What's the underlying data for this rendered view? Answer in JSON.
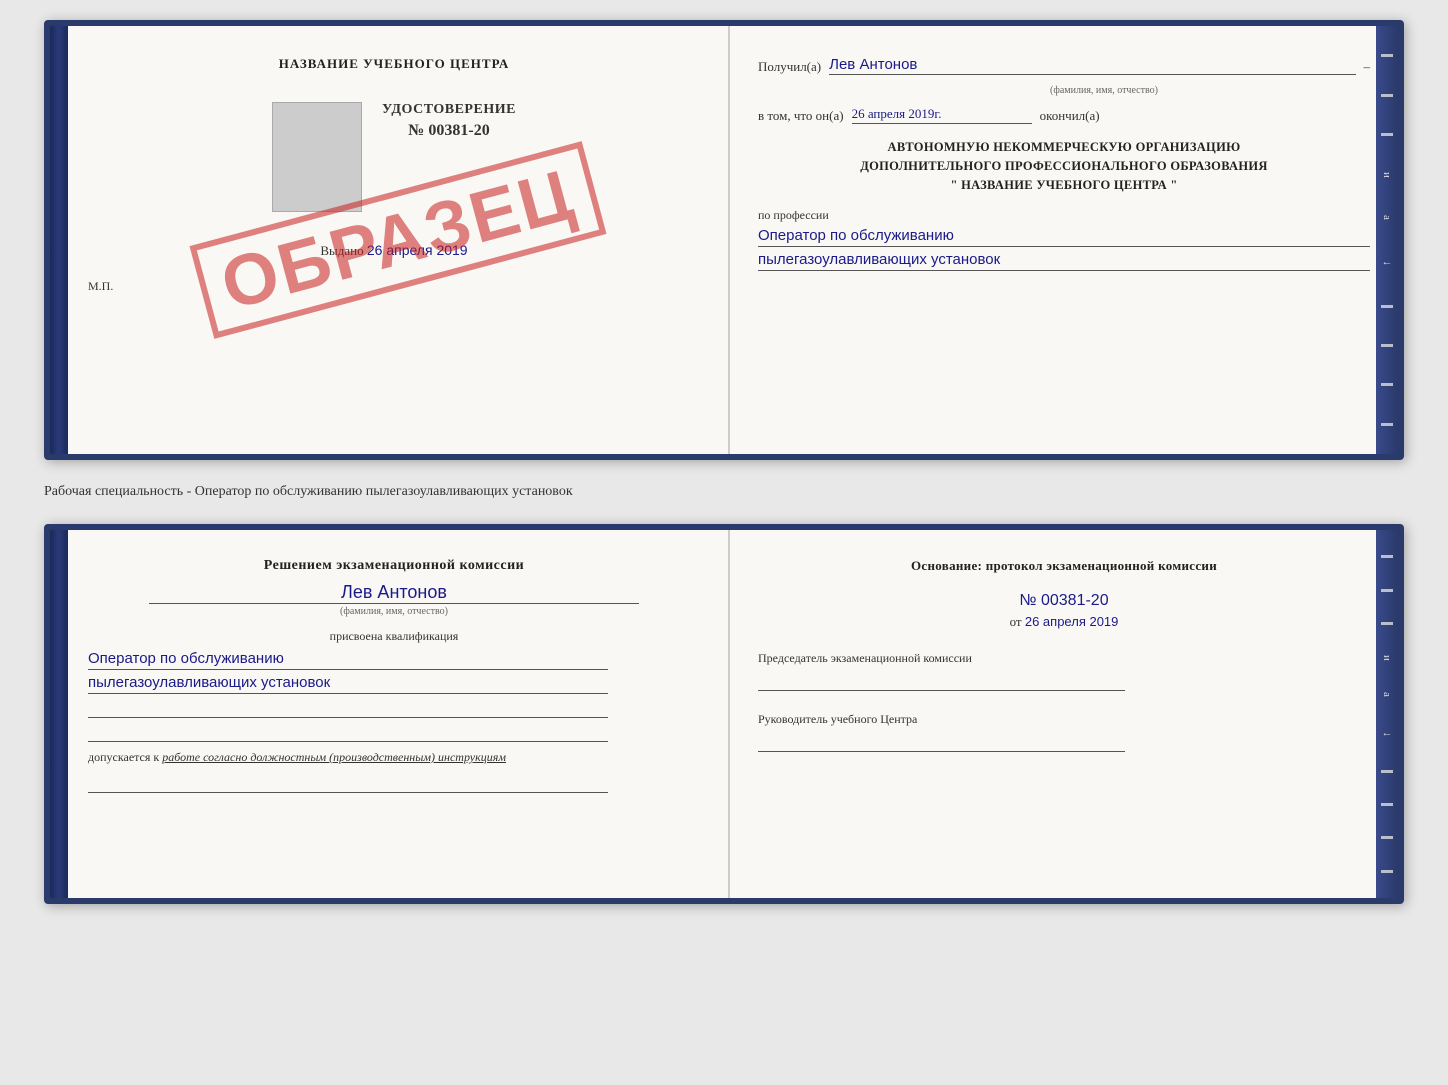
{
  "topSpread": {
    "left": {
      "title": "НАЗВАНИЕ УЧЕБНОГО ЦЕНТРА",
      "certType": "УДОСТОВЕРЕНИЕ",
      "certNumber": "№ 00381-20",
      "issued": "Выдано",
      "issuedDate": "26 апреля 2019",
      "mp": "М.П.",
      "stampText": "ОБРАЗЕЦ"
    },
    "right": {
      "receivedLabel": "Получил(а)",
      "receivedName": "Лев Антонов",
      "receivedSubtext": "(фамилия, имя, отчество)",
      "inThatLabel": "в том, что он(а)",
      "inThatDate": "26 апреля 2019г.",
      "finishedLabel": "окончил(а)",
      "org1": "АВТОНОМНУЮ НЕКОММЕРЧЕСКУЮ ОРГАНИЗАЦИЮ",
      "org2": "ДОПОЛНИТЕЛЬНОГО ПРОФЕССИОНАЛЬНОГО ОБРАЗОВАНИЯ",
      "org3": "\"  НАЗВАНИЕ УЧЕБНОГО ЦЕНТРА  \"",
      "professionLabel": "по профессии",
      "profession1": "Оператор по обслуживанию",
      "profession2": "пылегазоулавливающих установок"
    }
  },
  "middleLabel": "Рабочая специальность - Оператор по обслуживанию пылегазоулавливающих установок",
  "bottomSpread": {
    "left": {
      "decisionHeading": "Решением экзаменационной комиссии",
      "personName": "Лев Антонов",
      "personSubtext": "(фамилия, имя, отчество)",
      "qualificationLabel": "присвоена квалификация",
      "qualification1": "Оператор по обслуживанию",
      "qualification2": "пылегазоулавливающих установок",
      "admissionText": "допускается к",
      "admissionWork": "работе согласно должностным (производственным) инструкциям"
    },
    "right": {
      "basisHeading": "Основание: протокол экзаменационной комиссии",
      "protocolNumber": "№  00381-20",
      "protocolDatePrefix": "от",
      "protocolDate": "26 апреля 2019",
      "chairmanLabel": "Председатель экзаменационной комиссии",
      "directorLabel": "Руководитель учебного Центра"
    },
    "rightSideItems": [
      "-",
      "-",
      "-",
      "и",
      "а",
      "←",
      "-",
      "-",
      "-",
      "-"
    ]
  }
}
